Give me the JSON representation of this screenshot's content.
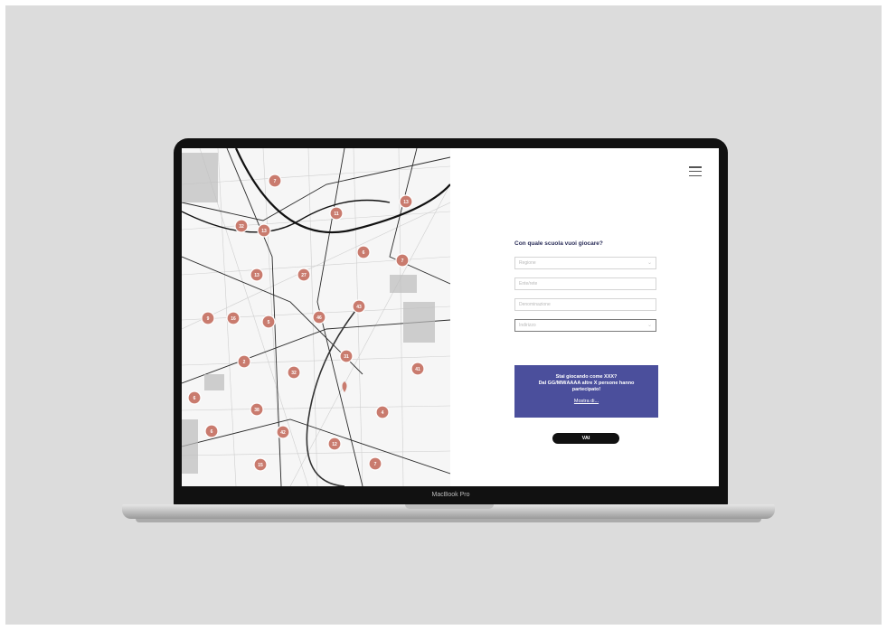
{
  "device": {
    "label": "MacBook Pro"
  },
  "menu": {
    "icon": "hamburger-menu-icon"
  },
  "form": {
    "question": "Con quale scuola vuoi giocare?",
    "fields": [
      {
        "placeholder": "Regione",
        "type": "select"
      },
      {
        "placeholder": "Ente/rete",
        "type": "input"
      },
      {
        "placeholder": "Denominazione",
        "type": "input"
      },
      {
        "placeholder": "Indirizzo",
        "type": "select"
      }
    ]
  },
  "info_box": {
    "line1": "Stai giocando come XXX?",
    "line2": "Dal GG/MM/AAAA altre X persone hanno partecipato!",
    "link": "Mostra di..."
  },
  "submit": {
    "label": "VAI"
  },
  "map": {
    "markers": [
      "7",
      "11",
      "13",
      "32",
      "13",
      "6",
      "7",
      "13",
      "27",
      "43",
      "9",
      "16",
      "5",
      "46",
      "31",
      "2",
      "32",
      "41",
      "6",
      "38",
      "6",
      "42",
      "4",
      "12",
      "15",
      "7"
    ],
    "marker_color": "#c97b6e"
  },
  "colors": {
    "accent": "#4b4f9c",
    "dark": "#111111"
  }
}
